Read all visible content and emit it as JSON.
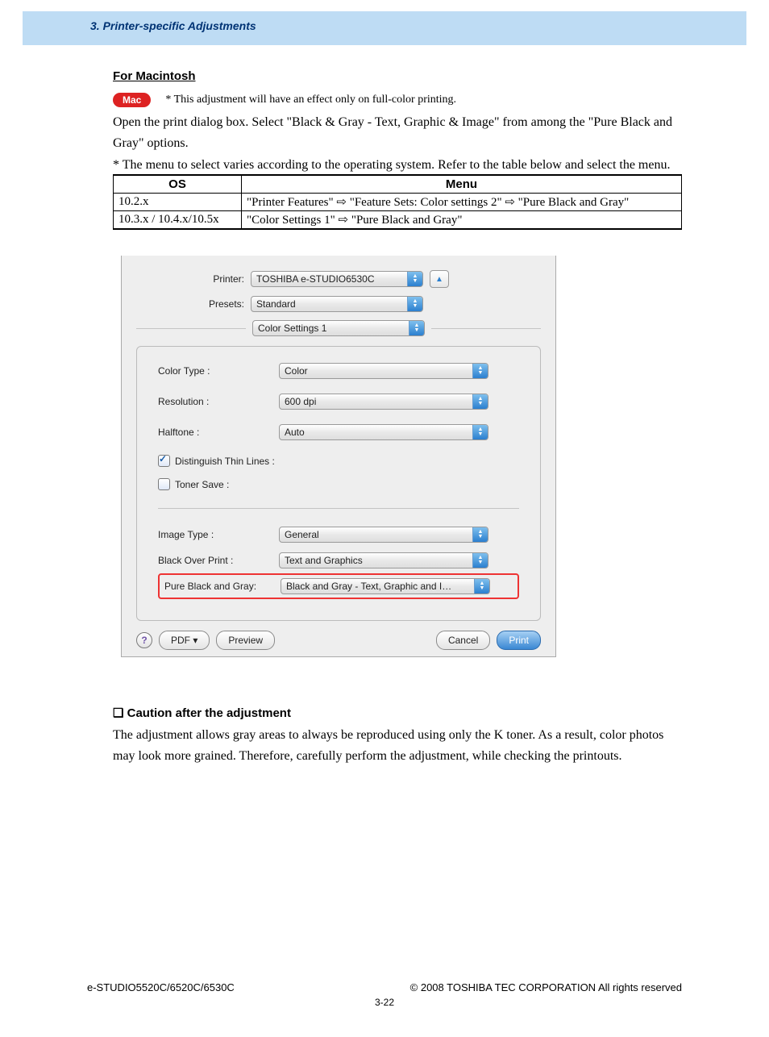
{
  "header": {
    "chapter_title": "3. Printer-specific Adjustments"
  },
  "section": {
    "heading": "For Macintosh",
    "mac_badge": "Mac",
    "mac_note": "* This adjustment will have an effect only on full-color printing.",
    "body_para": "Open the print dialog box.  Select \"Black & Gray - Text, Graphic & Image\" from among the \"Pure Black and Gray\" options.",
    "menu_note": "* The menu to select varies according to the operating system.  Refer to the table below and select the menu."
  },
  "menu_table": {
    "headers": {
      "os": "OS",
      "menu": "Menu"
    },
    "rows": [
      {
        "os": "10.2.x",
        "menu": "\"Printer Features\" ⇨ \"Feature Sets: Color settings 2\" ⇨ \"Pure Black and Gray\""
      },
      {
        "os": "10.3.x / 10.4.x/10.5x",
        "menu": "\"Color Settings 1\" ⇨ \"Pure Black and Gray\""
      }
    ]
  },
  "dialog": {
    "printer_label": "Printer:",
    "printer_value": "TOSHIBA e-STUDIO6530C",
    "expand_glyph": "▲",
    "presets_label": "Presets:",
    "presets_value": "Standard",
    "section_dropdown": "Color Settings 1",
    "fields": {
      "color_type_label": "Color Type :",
      "color_type_value": "Color",
      "resolution_label": "Resolution :",
      "resolution_value": "600 dpi",
      "halftone_label": "Halftone :",
      "halftone_value": "Auto",
      "distinguish_label": "Distinguish Thin Lines :",
      "toner_save_label": "Toner Save :",
      "image_type_label": "Image Type :",
      "image_type_value": "General",
      "black_overprint_label": "Black Over Print :",
      "black_overprint_value": "Text and Graphics",
      "pure_black_label": "Pure Black and Gray:",
      "pure_black_value": "Black and Gray - Text, Graphic and I…"
    },
    "footer": {
      "help_glyph": "?",
      "pdf_label": "PDF ▾",
      "preview_label": "Preview",
      "cancel_label": "Cancel",
      "print_label": "Print"
    }
  },
  "caution": {
    "heading": "❑ Caution after the adjustment",
    "body": "The adjustment allows gray areas to always be reproduced using only the K toner.  As a result, color photos may look more grained.  Therefore, carefully perform the adjustment, while checking the printouts."
  },
  "footer": {
    "model": "e-STUDIO5520C/6520C/6530C",
    "copyright": "© 2008 TOSHIBA TEC CORPORATION All rights reserved",
    "page_number": "3-22"
  }
}
